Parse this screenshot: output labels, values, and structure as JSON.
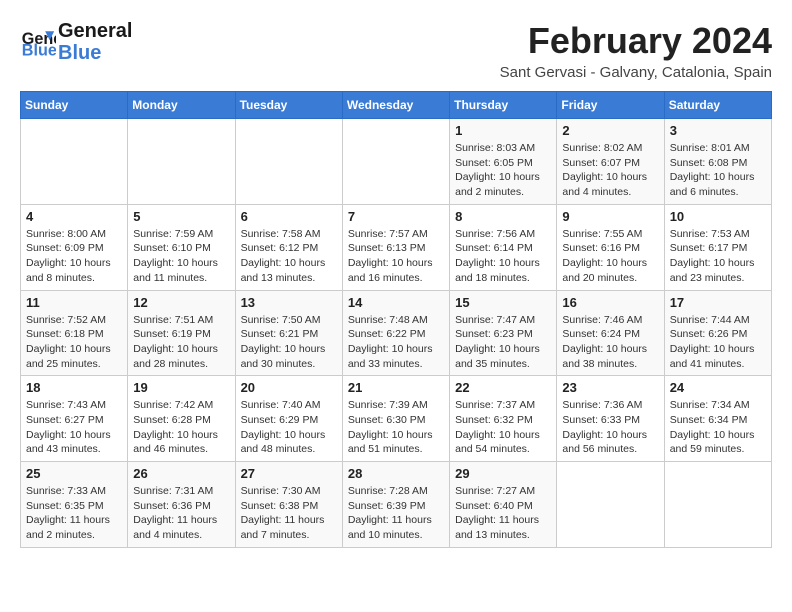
{
  "header": {
    "logo_line1": "General",
    "logo_line2": "Blue",
    "month_title": "February 2024",
    "subtitle": "Sant Gervasi - Galvany, Catalonia, Spain"
  },
  "days_of_week": [
    "Sunday",
    "Monday",
    "Tuesday",
    "Wednesday",
    "Thursday",
    "Friday",
    "Saturday"
  ],
  "weeks": [
    [
      {
        "day": "",
        "info": ""
      },
      {
        "day": "",
        "info": ""
      },
      {
        "day": "",
        "info": ""
      },
      {
        "day": "",
        "info": ""
      },
      {
        "day": "1",
        "info": "Sunrise: 8:03 AM\nSunset: 6:05 PM\nDaylight: 10 hours and 2 minutes."
      },
      {
        "day": "2",
        "info": "Sunrise: 8:02 AM\nSunset: 6:07 PM\nDaylight: 10 hours and 4 minutes."
      },
      {
        "day": "3",
        "info": "Sunrise: 8:01 AM\nSunset: 6:08 PM\nDaylight: 10 hours and 6 minutes."
      }
    ],
    [
      {
        "day": "4",
        "info": "Sunrise: 8:00 AM\nSunset: 6:09 PM\nDaylight: 10 hours and 8 minutes."
      },
      {
        "day": "5",
        "info": "Sunrise: 7:59 AM\nSunset: 6:10 PM\nDaylight: 10 hours and 11 minutes."
      },
      {
        "day": "6",
        "info": "Sunrise: 7:58 AM\nSunset: 6:12 PM\nDaylight: 10 hours and 13 minutes."
      },
      {
        "day": "7",
        "info": "Sunrise: 7:57 AM\nSunset: 6:13 PM\nDaylight: 10 hours and 16 minutes."
      },
      {
        "day": "8",
        "info": "Sunrise: 7:56 AM\nSunset: 6:14 PM\nDaylight: 10 hours and 18 minutes."
      },
      {
        "day": "9",
        "info": "Sunrise: 7:55 AM\nSunset: 6:16 PM\nDaylight: 10 hours and 20 minutes."
      },
      {
        "day": "10",
        "info": "Sunrise: 7:53 AM\nSunset: 6:17 PM\nDaylight: 10 hours and 23 minutes."
      }
    ],
    [
      {
        "day": "11",
        "info": "Sunrise: 7:52 AM\nSunset: 6:18 PM\nDaylight: 10 hours and 25 minutes."
      },
      {
        "day": "12",
        "info": "Sunrise: 7:51 AM\nSunset: 6:19 PM\nDaylight: 10 hours and 28 minutes."
      },
      {
        "day": "13",
        "info": "Sunrise: 7:50 AM\nSunset: 6:21 PM\nDaylight: 10 hours and 30 minutes."
      },
      {
        "day": "14",
        "info": "Sunrise: 7:48 AM\nSunset: 6:22 PM\nDaylight: 10 hours and 33 minutes."
      },
      {
        "day": "15",
        "info": "Sunrise: 7:47 AM\nSunset: 6:23 PM\nDaylight: 10 hours and 35 minutes."
      },
      {
        "day": "16",
        "info": "Sunrise: 7:46 AM\nSunset: 6:24 PM\nDaylight: 10 hours and 38 minutes."
      },
      {
        "day": "17",
        "info": "Sunrise: 7:44 AM\nSunset: 6:26 PM\nDaylight: 10 hours and 41 minutes."
      }
    ],
    [
      {
        "day": "18",
        "info": "Sunrise: 7:43 AM\nSunset: 6:27 PM\nDaylight: 10 hours and 43 minutes."
      },
      {
        "day": "19",
        "info": "Sunrise: 7:42 AM\nSunset: 6:28 PM\nDaylight: 10 hours and 46 minutes."
      },
      {
        "day": "20",
        "info": "Sunrise: 7:40 AM\nSunset: 6:29 PM\nDaylight: 10 hours and 48 minutes."
      },
      {
        "day": "21",
        "info": "Sunrise: 7:39 AM\nSunset: 6:30 PM\nDaylight: 10 hours and 51 minutes."
      },
      {
        "day": "22",
        "info": "Sunrise: 7:37 AM\nSunset: 6:32 PM\nDaylight: 10 hours and 54 minutes."
      },
      {
        "day": "23",
        "info": "Sunrise: 7:36 AM\nSunset: 6:33 PM\nDaylight: 10 hours and 56 minutes."
      },
      {
        "day": "24",
        "info": "Sunrise: 7:34 AM\nSunset: 6:34 PM\nDaylight: 10 hours and 59 minutes."
      }
    ],
    [
      {
        "day": "25",
        "info": "Sunrise: 7:33 AM\nSunset: 6:35 PM\nDaylight: 11 hours and 2 minutes."
      },
      {
        "day": "26",
        "info": "Sunrise: 7:31 AM\nSunset: 6:36 PM\nDaylight: 11 hours and 4 minutes."
      },
      {
        "day": "27",
        "info": "Sunrise: 7:30 AM\nSunset: 6:38 PM\nDaylight: 11 hours and 7 minutes."
      },
      {
        "day": "28",
        "info": "Sunrise: 7:28 AM\nSunset: 6:39 PM\nDaylight: 11 hours and 10 minutes."
      },
      {
        "day": "29",
        "info": "Sunrise: 7:27 AM\nSunset: 6:40 PM\nDaylight: 11 hours and 13 minutes."
      },
      {
        "day": "",
        "info": ""
      },
      {
        "day": "",
        "info": ""
      }
    ]
  ]
}
